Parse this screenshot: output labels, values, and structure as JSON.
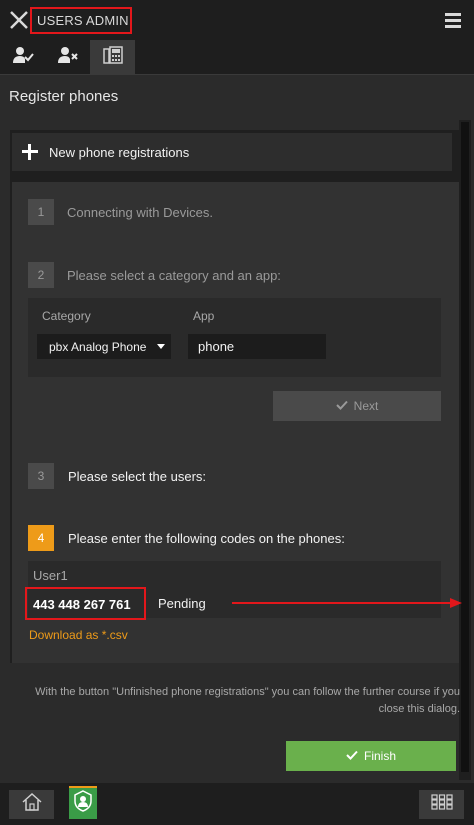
{
  "header": {
    "title": "USERS ADMIN",
    "close_icon": "close-icon",
    "menu_icon": "hamburger-menu-icon"
  },
  "tabs": [
    {
      "icon": "user-check-icon",
      "active": false
    },
    {
      "icon": "user-remove-icon",
      "active": false
    },
    {
      "icon": "phone-device-icon",
      "active": true
    }
  ],
  "page": {
    "heading": "Register phones"
  },
  "new_registration": {
    "label": "New phone registrations"
  },
  "steps": [
    {
      "number": "1",
      "label": "Connecting with Devices."
    },
    {
      "number": "2",
      "label": "Please select a category and an app:"
    },
    {
      "number": "3",
      "label": "Please select the users:"
    },
    {
      "number": "4",
      "label": "Please enter the following codes on the phones:"
    }
  ],
  "category": {
    "label": "Category",
    "selected": "pbx Analog Phone"
  },
  "app": {
    "label": "App",
    "value": "phone"
  },
  "next_button": {
    "label": "Next"
  },
  "registration": {
    "user": "User1",
    "code": "443 448 267 761",
    "status": "Pending"
  },
  "download": {
    "label": "Download as *.csv"
  },
  "info": {
    "text": "With the button \"Unfinished phone registrations\" you can follow the further course if you close this dialog."
  },
  "finish_button": {
    "label": "Finish"
  },
  "bottom_nav": {
    "home_icon": "home-icon",
    "users_icon": "users-admin-icon",
    "apps_icon": "apps-grid-icon"
  },
  "colors": {
    "accent_orange": "#ee9b19",
    "finish_green": "#6ab04c",
    "highlight_red": "#e3171b",
    "background": "#2b2b2b"
  }
}
